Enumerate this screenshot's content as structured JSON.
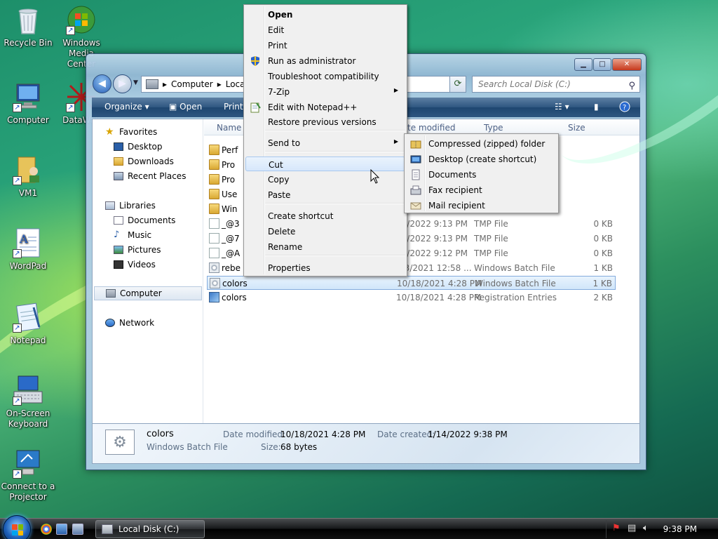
{
  "desktop": {
    "icons": [
      {
        "label": "Recycle Bin"
      },
      {
        "label": "Windows Media Center"
      },
      {
        "label": "Computer"
      },
      {
        "label": "DataWall"
      },
      {
        "label": "VM1"
      },
      {
        "label": "WordPad"
      },
      {
        "label": "Notepad"
      },
      {
        "label": "On-Screen Keyboard"
      },
      {
        "label": "Connect to a Projector"
      }
    ]
  },
  "window": {
    "title": "Local Disk (C:)",
    "address": {
      "segments": [
        "Computer",
        "Local"
      ]
    },
    "search_placeholder": "Search Local Disk (C:)",
    "toolbar": {
      "organize": "Organize",
      "open": "Open",
      "print": "Print"
    },
    "nav": {
      "favorites_header": "Favorites",
      "favorites": [
        "Desktop",
        "Downloads",
        "Recent Places"
      ],
      "libraries_header": "Libraries",
      "libraries": [
        "Documents",
        "Music",
        "Pictures",
        "Videos"
      ],
      "computer": "Computer",
      "network": "Network"
    },
    "columns": {
      "name": "Name",
      "date": "te modified",
      "type": "Type",
      "size": "Size"
    },
    "files": [
      {
        "name": "Perf",
        "date": "",
        "type": "",
        "size": "",
        "icon": "folder"
      },
      {
        "name": "Pro",
        "date": "",
        "type": "",
        "size": "",
        "icon": "folder"
      },
      {
        "name": "Pro",
        "date": "",
        "type": "",
        "size": "",
        "icon": "folder"
      },
      {
        "name": "Use",
        "date": "",
        "type": "",
        "size": "",
        "icon": "folder"
      },
      {
        "name": "Win",
        "date": "",
        "type": "",
        "size": "",
        "icon": "folder"
      },
      {
        "name": "_@3",
        "date": "14/2022 9:13 PM",
        "type": "TMP File",
        "size": "0 KB",
        "icon": "file"
      },
      {
        "name": "_@7",
        "date": "14/2022 9:13 PM",
        "type": "TMP File",
        "size": "0 KB",
        "icon": "file"
      },
      {
        "name": "_@A",
        "date": "14/2022 9:12 PM",
        "type": "TMP File",
        "size": "0 KB",
        "icon": "file"
      },
      {
        "name": "rebe",
        "date": "/23/2021 12:58 ...",
        "type": "Windows Batch File",
        "size": "1 KB",
        "icon": "bat"
      },
      {
        "name": "colors",
        "date": "10/18/2021 4:28 PM",
        "type": "Windows Batch File",
        "size": "1 KB",
        "icon": "bat"
      },
      {
        "name": "colors",
        "date": "10/18/2021 4:28 PM",
        "type": "Registration Entries",
        "size": "2 KB",
        "icon": "reg"
      }
    ],
    "details": {
      "name": "colors",
      "type": "Windows Batch File",
      "date_modified_label": "Date modified:",
      "date_modified": "10/18/2021 4:28 PM",
      "size_label": "Size:",
      "size": "68 bytes",
      "date_created_label": "Date created:",
      "date_created": "1/14/2022 9:38 PM"
    }
  },
  "context_menu": {
    "items": [
      "Open",
      "Edit",
      "Print",
      "Run as administrator",
      "Troubleshoot compatibility",
      "7-Zip",
      "Edit with Notepad++",
      "Restore previous versions",
      "Send to",
      "Cut",
      "Copy",
      "Paste",
      "Create shortcut",
      "Delete",
      "Rename",
      "Properties"
    ],
    "hovered": "Cut"
  },
  "send_to_menu": {
    "items": [
      "Compressed (zipped) folder",
      "Desktop (create shortcut)",
      "Documents",
      "Fax recipient",
      "Mail recipient"
    ]
  },
  "taskbar": {
    "task_label": "Local Disk (C:)",
    "clock": "9:38 PM"
  },
  "colors": {
    "accent": "#2e5680",
    "selection": "#d1e6fa"
  }
}
